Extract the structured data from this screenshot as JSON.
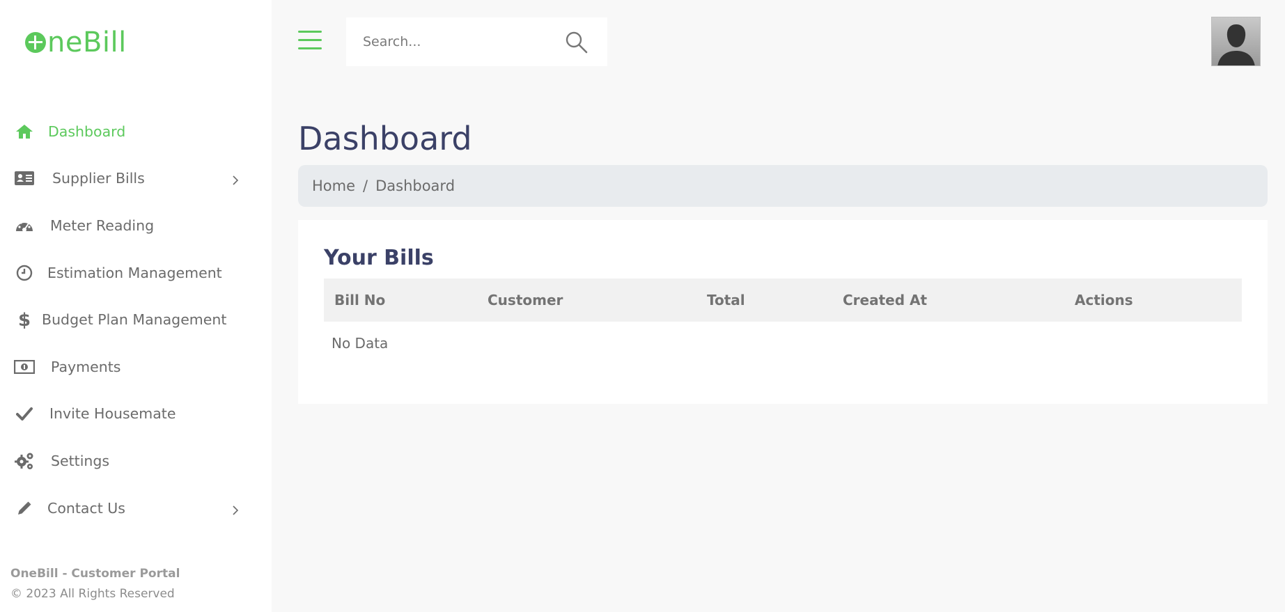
{
  "brand": {
    "logo_text": "neBill",
    "logo_mark": "O"
  },
  "search": {
    "placeholder": "Search..."
  },
  "sidebar": {
    "items": [
      {
        "label": "Dashboard",
        "icon": "home-icon",
        "active": true
      },
      {
        "label": "Supplier Bills",
        "icon": "id-card-icon",
        "has_submenu": true
      },
      {
        "label": "Meter Reading",
        "icon": "gauge-icon"
      },
      {
        "label": "Estimation Management",
        "icon": "clock-icon"
      },
      {
        "label": "Budget Plan Management",
        "icon": "dollar-icon"
      },
      {
        "label": "Payments",
        "icon": "money-bill-icon"
      },
      {
        "label": "Invite Housemate",
        "icon": "check-icon"
      },
      {
        "label": "Settings",
        "icon": "gears-icon"
      },
      {
        "label": "Contact Us",
        "icon": "pencil-icon",
        "has_submenu": true
      }
    ],
    "footer": {
      "brand": "OneBill - Customer Portal",
      "copyright": "© 2023 All Rights Reserved"
    }
  },
  "page": {
    "title": "Dashboard",
    "breadcrumb": {
      "home": "Home",
      "separator": "/",
      "current": "Dashboard"
    }
  },
  "bills": {
    "title": "Your Bills",
    "columns": [
      "Bill No",
      "Customer",
      "Total",
      "Created At",
      "Actions"
    ],
    "rows": [],
    "empty_text": "No Data"
  },
  "colors": {
    "accent": "#5cc95c",
    "heading": "#3b4167",
    "text": "#6b6b6b",
    "breadcrumb_bg": "#e8ebee",
    "page_bg": "#f8f8f8"
  }
}
